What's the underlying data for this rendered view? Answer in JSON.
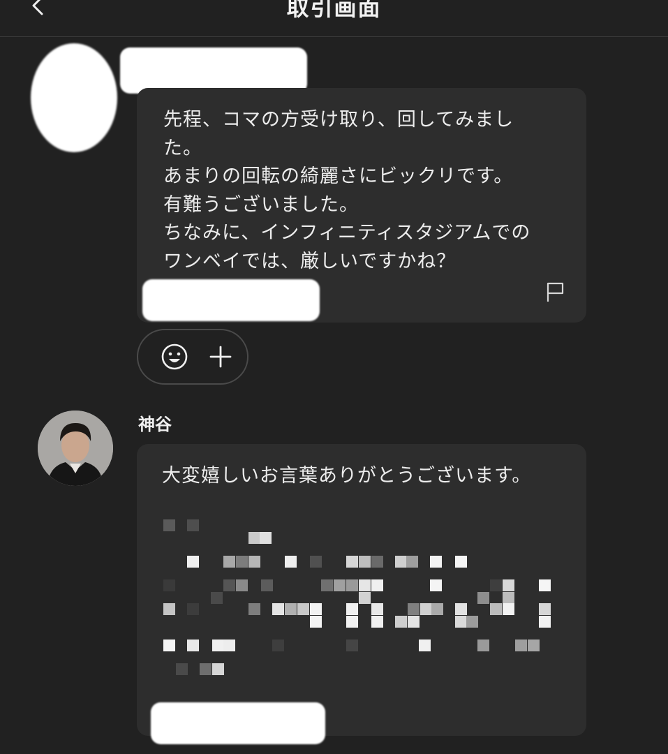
{
  "header": {
    "title": "取引画面",
    "back_icon": "chevron-left-icon"
  },
  "message1": {
    "lines": [
      "先程、コマの方受け取り、回してみまし",
      "た。",
      "あまりの回転の綺麗さにビックリです。",
      "有難うございました。",
      "ちなみに、インフィニティスタジアムでの",
      "ワンベイでは、厳しいですかね？"
    ],
    "flag_icon": "flag-icon"
  },
  "reactions": {
    "emoji_icon": "smiley-icon",
    "add_icon": "plus-icon"
  },
  "message2": {
    "user_name": "神谷",
    "text": "大変嬉しいお言葉ありがとうございます。"
  },
  "colors": {
    "background": "#212121",
    "bubble": "#2d2d2d",
    "text": "#ececec",
    "divider": "#3a3a3a"
  }
}
